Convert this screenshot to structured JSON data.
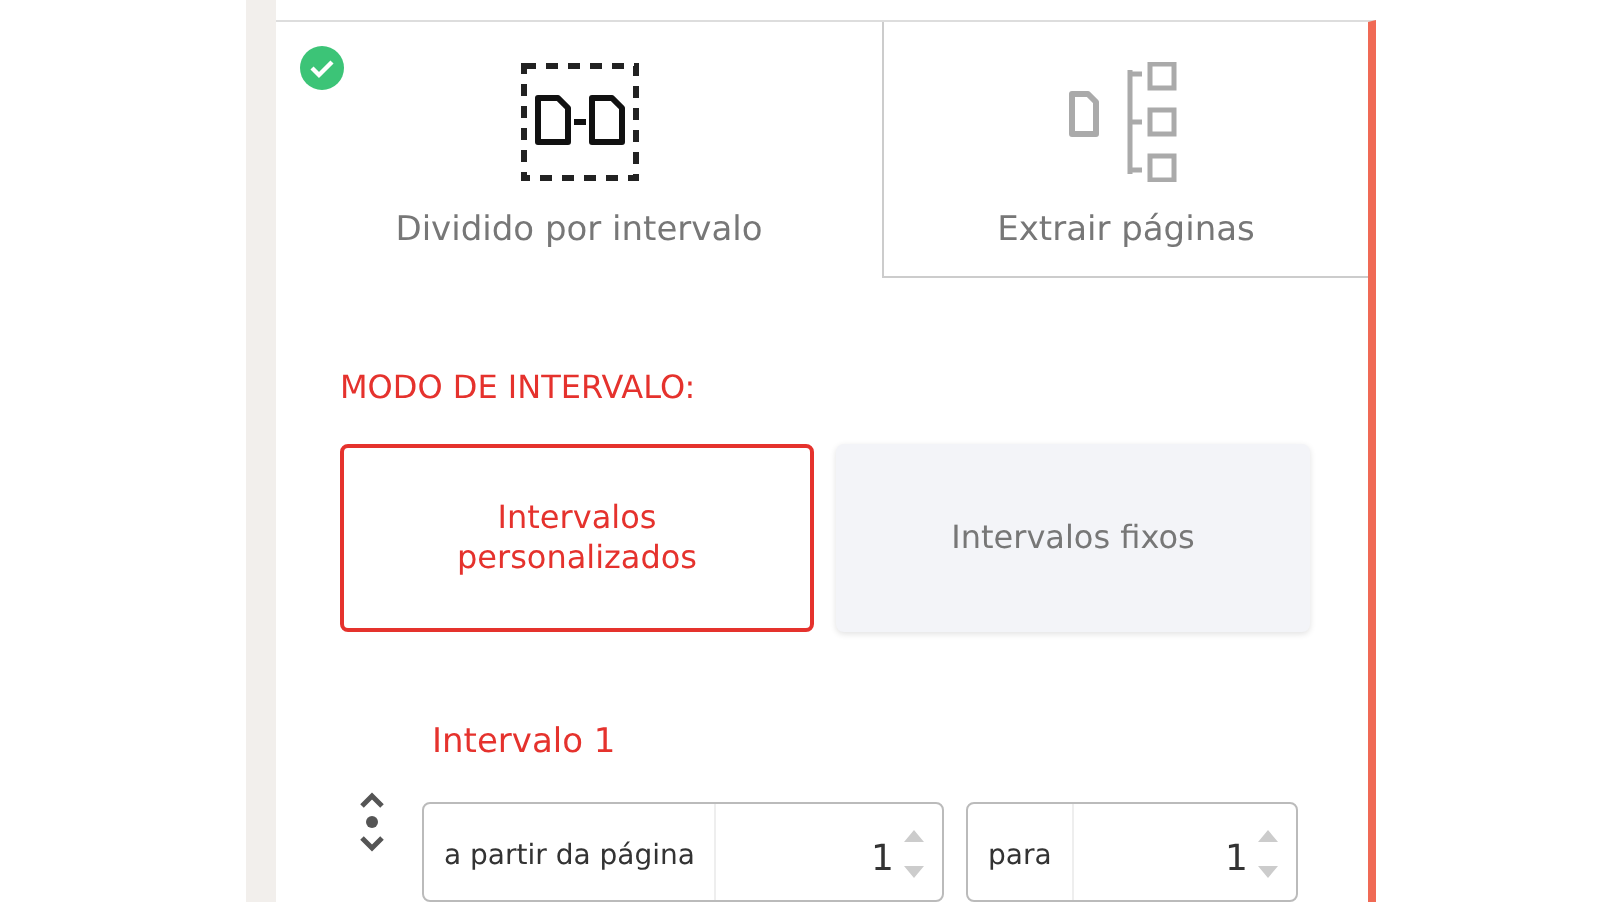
{
  "tabs": [
    {
      "label": "Dividido por intervalo",
      "kind": "range",
      "selected": true
    },
    {
      "label": "Extrair páginas",
      "kind": "extract",
      "selected": false
    }
  ],
  "mode": {
    "title": "MODO DE INTERVALO:",
    "options": [
      {
        "label": "Intervalos personalizados",
        "selected": true
      },
      {
        "label": "Intervalos fixos",
        "selected": false
      }
    ]
  },
  "range": {
    "title": "Intervalo 1",
    "fields": [
      {
        "label": "a partir da página",
        "value": "1"
      },
      {
        "label": "para",
        "value": "1"
      }
    ]
  }
}
